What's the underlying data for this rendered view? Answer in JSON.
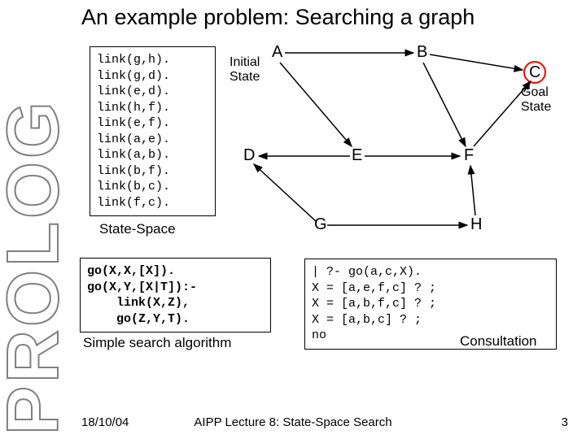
{
  "header": {
    "sidebar_text": "PROLOG",
    "title": "An example problem: Searching a graph"
  },
  "state_space": {
    "code": "link(g,h).\nlink(g,d).\nlink(e,d).\nlink(h,f).\nlink(e,f).\nlink(a,e).\nlink(a,b).\nlink(b,f).\nlink(b,c).\nlink(f,c).",
    "label": "State-Space"
  },
  "search_algo": {
    "code": "go(X,X,[X]).\ngo(X,Y,[X|T]):-\n    link(X,Z),\n    go(Z,Y,T).",
    "label": "Simple search algorithm"
  },
  "consultation": {
    "code": "| ?- go(a,c,X).\nX = [a,e,f,c] ? ;\nX = [a,b,f,c] ? ;\nX = [a,b,c] ? ;\nno",
    "label": "Consultation"
  },
  "graph": {
    "initial_label": "Initial\nState",
    "goal_label": "Goal\nState",
    "nodes": {
      "A": "A",
      "B": "B",
      "C": "C",
      "D": "D",
      "E": "E",
      "F": "F",
      "G": "G",
      "H": "H"
    }
  },
  "footer": {
    "date": "18/10/04",
    "center": "AIPP Lecture 8: State-Space Search",
    "page": "3"
  }
}
